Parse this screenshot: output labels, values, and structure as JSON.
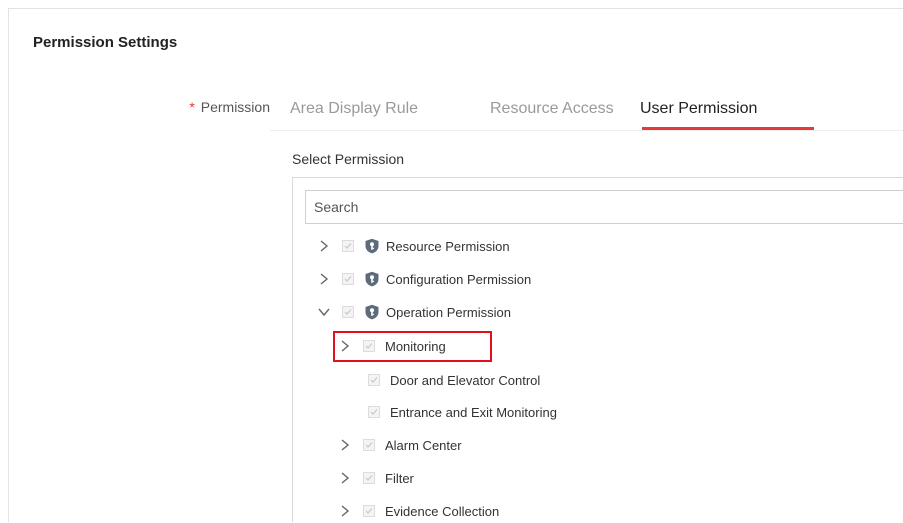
{
  "section": {
    "title": "Permission Settings"
  },
  "permission_field": {
    "required_mark": "*",
    "label": "Permission"
  },
  "tabs": [
    {
      "label": "Area Display Rule",
      "active": false
    },
    {
      "label": "Resource Access",
      "active": false
    },
    {
      "label": "User Permission",
      "active": true
    }
  ],
  "select_permission": {
    "label": "Select Permission",
    "search_placeholder": "Search"
  },
  "tree": {
    "items": [
      {
        "label": "Resource Permission",
        "level": 0,
        "expanded": false,
        "icon": "shield-key-icon",
        "checked": true
      },
      {
        "label": "Configuration Permission",
        "level": 0,
        "expanded": false,
        "icon": "shield-key-icon",
        "checked": true
      },
      {
        "label": "Operation Permission",
        "level": 0,
        "expanded": true,
        "icon": "shield-key-icon",
        "checked": true
      },
      {
        "label": "Monitoring",
        "level": 1,
        "expandable": true,
        "highlighted": true,
        "checked": true
      },
      {
        "label": "Door and Elevator Control",
        "level": 1,
        "expandable": false,
        "checked": true
      },
      {
        "label": "Entrance and Exit Monitoring",
        "level": 1,
        "expandable": false,
        "checked": true
      },
      {
        "label": "Alarm Center",
        "level": 1,
        "expandable": true,
        "checked": true
      },
      {
        "label": "Filter",
        "level": 1,
        "expandable": true,
        "checked": true
      },
      {
        "label": "Evidence Collection",
        "level": 1,
        "expandable": true,
        "checked": true
      }
    ]
  },
  "colors": {
    "accent": "#e5393a",
    "highlight_box": "#e3101c",
    "shield_icon": "#5f6b7a",
    "inactive_tab": "#9a9a9a"
  }
}
